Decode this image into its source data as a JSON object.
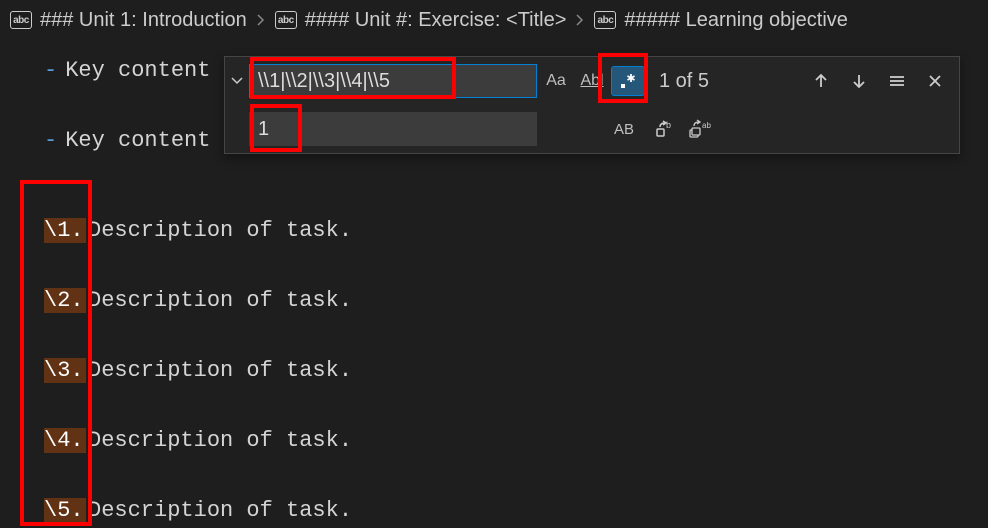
{
  "breadcrumbs": {
    "items": [
      {
        "label": "### Unit 1: Introduction"
      },
      {
        "label": "#### Unit #: Exercise: <Title>"
      },
      {
        "label": "##### Learning objective"
      }
    ]
  },
  "editor": {
    "key_lines": [
      {
        "text": "Key content"
      },
      {
        "text": "Key content"
      }
    ],
    "tasks": [
      {
        "num": "\\1.",
        "desc": "Description of task."
      },
      {
        "num": "\\2.",
        "desc": "Description of task."
      },
      {
        "num": "\\3.",
        "desc": "Description of task."
      },
      {
        "num": "\\4.",
        "desc": "Description of task."
      },
      {
        "num": "\\5.",
        "desc": "Description of task."
      }
    ]
  },
  "find": {
    "search_value": "\\\\1|\\\\2|\\\\3|\\\\4|\\\\5",
    "replace_value": "1",
    "case_label": "Aa",
    "word_label": "Abl",
    "regex_label": ".*",
    "preserve_label": "AB",
    "status": "1 of 5"
  }
}
